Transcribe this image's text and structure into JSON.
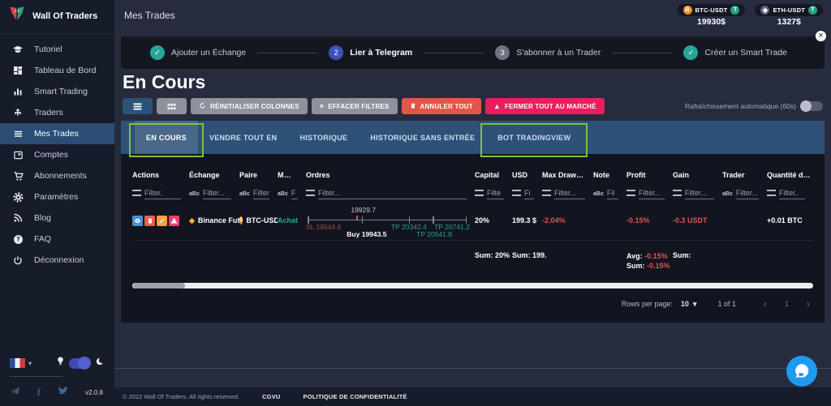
{
  "colors": {
    "accent_blue": "#2d5177",
    "sidebar_active_blue": "#2c4d73",
    "annotation_green": "#7dc242",
    "negative_red": "#e05252",
    "positive_teal": "#26a69a",
    "danger_red": "#e25648",
    "pink": "#ea1e5e",
    "bitcoin_orange": "#f7931a",
    "tether_teal": "#26a17b",
    "binance_gold": "#f3ba2f"
  },
  "icons": {
    "check": "✓",
    "close": "×",
    "clear": "×",
    "warning": "▲",
    "caret_down": "▾",
    "prev": "‹",
    "next": "›",
    "binance_diamond": "◆",
    "abc_filter": "aBc"
  },
  "topbar": {
    "title": "Mes Trades",
    "tickers": [
      {
        "pair": "BTC-USDT",
        "price": "19930$",
        "base_symbol": "B",
        "quote_symbol": "T"
      },
      {
        "pair": "ETH-USDT",
        "price": "1327$",
        "base_symbol": "◆",
        "quote_symbol": "T"
      }
    ]
  },
  "sidebar": {
    "brand": "Wall Of Traders",
    "items": [
      {
        "label": "Tutoriel",
        "icon": "graduation-cap"
      },
      {
        "label": "Tableau de Bord",
        "icon": "dashboard"
      },
      {
        "label": "Smart Trading",
        "icon": "bar-chart"
      },
      {
        "label": "Traders",
        "icon": "person"
      },
      {
        "label": "Mes Trades",
        "icon": "list"
      },
      {
        "label": "Comptes",
        "icon": "account-card"
      },
      {
        "label": "Abonnements",
        "icon": "shopping-cart"
      },
      {
        "label": "Paramètres",
        "icon": "gear"
      },
      {
        "label": "Blog",
        "icon": "rss"
      },
      {
        "label": "FAQ",
        "icon": "question"
      },
      {
        "label": "Déconnexion",
        "icon": "power"
      }
    ],
    "version": "v2.0.8"
  },
  "stepper": {
    "steps": [
      {
        "label": "Ajouter un Échange",
        "symbol": "✓",
        "state": "done"
      },
      {
        "label": "Lier à Telegram",
        "symbol": "2",
        "state": "current"
      },
      {
        "label": "S'abonner à un Trader",
        "symbol": "3",
        "state": "pending"
      },
      {
        "label": "Créer un Smart Trade",
        "symbol": "✓",
        "state": "done"
      }
    ]
  },
  "page": {
    "title": "En Cours"
  },
  "toolbar": {
    "reset_columns": "RÉINITIALISER COLONNES",
    "clear_filters": "EFFACER FILTRES",
    "cancel_all": "ANNULER TOUT",
    "close_all_market": "FERMER TOUT AU MARCHÉ",
    "auto_refresh": "Rafraîchissement automatique (60s)"
  },
  "tabs": [
    {
      "label": "EN COURS"
    },
    {
      "label": "VENDRE TOUT EN"
    },
    {
      "label": "HISTORIQUE"
    },
    {
      "label": "HISTORIQUE SANS ENTRÉE"
    },
    {
      "label": "BOT TRADINGVIEW"
    }
  ],
  "table": {
    "columns": [
      {
        "label": "Actions",
        "filter": "Filter."
      },
      {
        "label": "Échange",
        "filter": "Filter..."
      },
      {
        "label": "Paire",
        "filter": "Filter"
      },
      {
        "label": "M…",
        "filter": "F"
      },
      {
        "label": "Ordres",
        "filter": "Filter..."
      },
      {
        "label": "Capital",
        "filter": "Filte"
      },
      {
        "label": "USD",
        "filter": "Fi"
      },
      {
        "label": "Max Draw…",
        "filter": "Filter..."
      },
      {
        "label": "Note",
        "filter": "Fil"
      },
      {
        "label": "Profit",
        "filter": "Filter..."
      },
      {
        "label": "Gain",
        "filter": "Filter..."
      },
      {
        "label": "Trader",
        "filter": "Filter..."
      },
      {
        "label": "Quantité d…",
        "filter": "Filter.."
      }
    ],
    "row": {
      "exchange": "Binance Futu",
      "pair": "BTC-USDT",
      "side": "Achat",
      "orders": {
        "current_price": "19929.7",
        "stop_loss": "SL 19544.6",
        "buy": "Buy 19943.5",
        "tp1": "TP 20342.4",
        "tp2": "TP 20541.8",
        "tp3": "TP 20741.2"
      },
      "capital": "20%",
      "usd": "199.3 $",
      "max_drawdown": "-2.04%",
      "profit": "-0.15%",
      "gain": "-0.3 USDT",
      "quantity": "+0.01 BTC"
    },
    "summary": {
      "capital": {
        "label": "Sum:",
        "value": "20%"
      },
      "usd": {
        "label": "Sum:",
        "value": "199."
      },
      "profit_avg": {
        "label": "Avg:",
        "value": "-0.15%"
      },
      "profit_sum": {
        "label": "Sum:",
        "value": "-0.15%"
      },
      "gain": {
        "label": "Sum:",
        "value": ""
      }
    }
  },
  "pagination": {
    "rows_per_page_label": "Rows per page:",
    "rows_per_page": "10",
    "page_info": "1 of 1",
    "current_page": "1"
  },
  "footer": {
    "copyright": "© 2022 Wall Of Traders. All rights reserved.",
    "cgvu": "CGVU",
    "privacy": "POLITIQUE DE CONFIDENTIALITÉ"
  }
}
